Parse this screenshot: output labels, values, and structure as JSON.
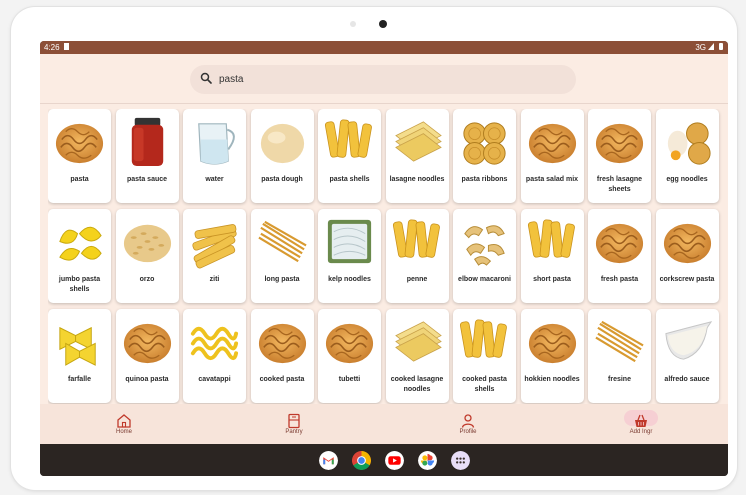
{
  "status_bar": {
    "time": "4:26",
    "network": "3G"
  },
  "search": {
    "value": "pasta",
    "placeholder": ""
  },
  "ingredients": [
    {
      "label": "pasta",
      "image": "fusilli"
    },
    {
      "label": "pasta sauce",
      "image": "sauce-jar"
    },
    {
      "label": "water",
      "image": "water-jug"
    },
    {
      "label": "pasta dough",
      "image": "dough-ball"
    },
    {
      "label": "pasta shells",
      "image": "penne"
    },
    {
      "label": "lasagne noodles",
      "image": "lasagne"
    },
    {
      "label": "pasta ribbons",
      "image": "nests"
    },
    {
      "label": "pasta salad mix",
      "image": "fusilli"
    },
    {
      "label": "fresh lasagne sheets",
      "image": "fusilli"
    },
    {
      "label": "egg noodles",
      "image": "egg-nests"
    },
    {
      "label": "jumbo pasta shells",
      "image": "shells"
    },
    {
      "label": "orzo",
      "image": "orzo"
    },
    {
      "label": "ziti",
      "image": "ziti"
    },
    {
      "label": "long pasta",
      "image": "spaghetti"
    },
    {
      "label": "kelp noodles",
      "image": "kelp"
    },
    {
      "label": "penne",
      "image": "penne"
    },
    {
      "label": "elbow macaroni",
      "image": "elbow"
    },
    {
      "label": "short pasta",
      "image": "penne"
    },
    {
      "label": "fresh pasta",
      "image": "fusilli"
    },
    {
      "label": "corkscrew pasta",
      "image": "fusilli"
    },
    {
      "label": "farfalle",
      "image": "farfalle"
    },
    {
      "label": "quinoa pasta",
      "image": "fusilli"
    },
    {
      "label": "cavatappi",
      "image": "cavatappi"
    },
    {
      "label": "cooked pasta",
      "image": "fusilli"
    },
    {
      "label": "tubetti",
      "image": "fusilli"
    },
    {
      "label": "cooked lasagne noodles",
      "image": "lasagne"
    },
    {
      "label": "cooked pasta shells",
      "image": "penne"
    },
    {
      "label": "hokkien noodles",
      "image": "fusilli"
    },
    {
      "label": "fresine",
      "image": "spaghetti"
    },
    {
      "label": "alfredo sauce",
      "image": "sauce-boat"
    }
  ],
  "nav": {
    "home": {
      "label": "Home",
      "icon": "home-icon"
    },
    "pantry": {
      "label": "Pantry",
      "icon": "pantry-icon"
    },
    "profile": {
      "label": "Profile",
      "icon": "profile-icon"
    },
    "add": {
      "label": "Add Ingr",
      "icon": "basket-icon",
      "active": true
    }
  },
  "dock": [
    "gmail-icon",
    "chrome-icon",
    "youtube-icon",
    "photos-icon",
    "app-drawer-icon"
  ],
  "colors": {
    "status_bar": "#8c4f37",
    "app_background": "#fbece3",
    "nav_accent": "#c0392b",
    "nav_active_pill": "#f6cfd3"
  }
}
